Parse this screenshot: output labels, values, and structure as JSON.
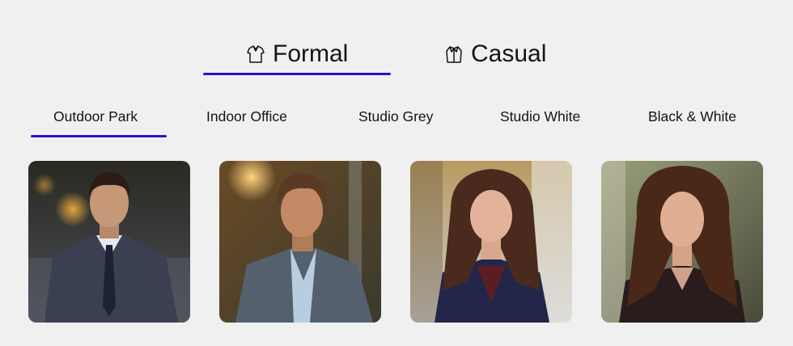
{
  "style_tabs": [
    {
      "label": "Formal",
      "icon": "formal-shirt-icon",
      "active": true
    },
    {
      "label": "Casual",
      "icon": "casual-jacket-icon",
      "active": false
    }
  ],
  "background_tabs": [
    {
      "label": "Outdoor Park",
      "active": true
    },
    {
      "label": "Indoor Office",
      "active": false
    },
    {
      "label": "Studio Grey",
      "active": false
    },
    {
      "label": "Studio White",
      "active": false
    },
    {
      "label": "Black & White",
      "active": false
    }
  ],
  "photos": [
    {
      "subject": "man-dark-suit-tie",
      "scene": "dusk-park"
    },
    {
      "subject": "man-blazer-open-collar",
      "scene": "sunlit-trees"
    },
    {
      "subject": "woman-navy-blazer",
      "scene": "sunny-street"
    },
    {
      "subject": "woman-curly-hair",
      "scene": "park-trees"
    }
  ],
  "colors": {
    "accent": "#2b0fd6",
    "background": "#f0f0f0",
    "text": "#141414"
  }
}
